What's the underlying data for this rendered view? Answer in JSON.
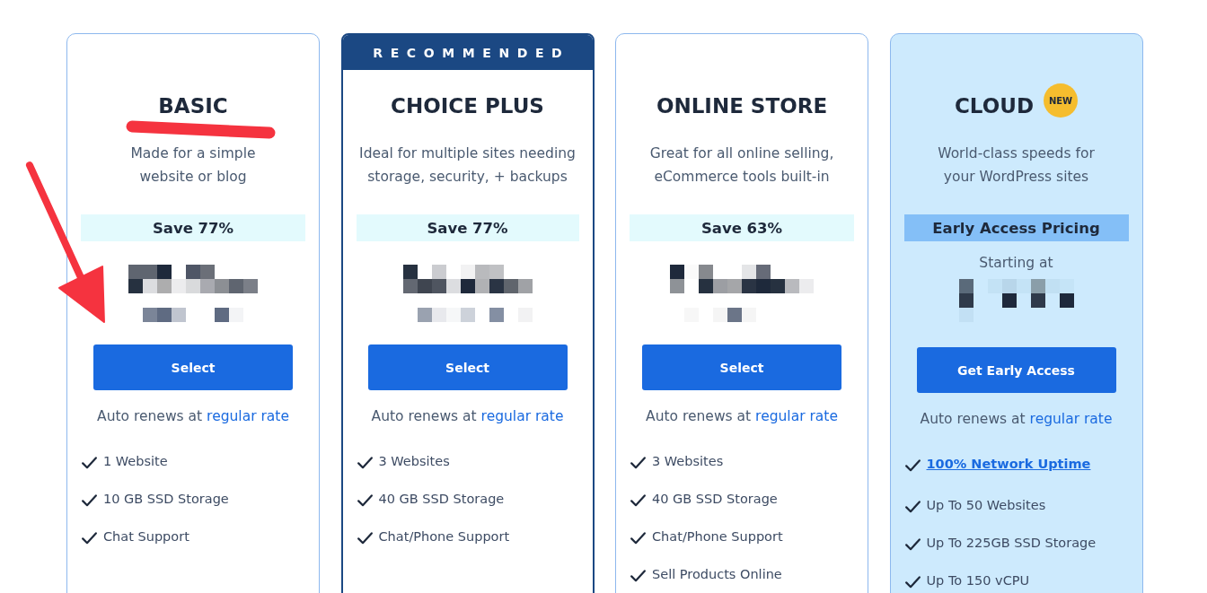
{
  "plans": [
    {
      "kind": "standard",
      "title": "BASIC",
      "description": [
        "Made for a simple",
        "website or blog"
      ],
      "deal": {
        "kind": "discount",
        "text": "Save 77%"
      },
      "button": "Select",
      "renewal": {
        "text": "Auto renews at",
        "link": "regular rate"
      },
      "features": [
        {
          "kind": "plain",
          "text": "1 Website"
        },
        {
          "kind": "plain",
          "text": "10 GB SSD Storage"
        },
        {
          "kind": "plain",
          "text": "Chat Support"
        }
      ]
    },
    {
      "kind": "recommended",
      "banner": "RECOMMENDED",
      "title": "CHOICE PLUS",
      "description": [
        "Ideal for multiple sites needing",
        "storage, security, + backups"
      ],
      "deal": {
        "kind": "discount",
        "text": "Save 77%"
      },
      "button": "Select",
      "renewal": {
        "text": "Auto renews at",
        "link": "regular rate"
      },
      "features": [
        {
          "kind": "plain",
          "text": "3 Websites"
        },
        {
          "kind": "plain",
          "text": "40 GB SSD Storage"
        },
        {
          "kind": "plain",
          "text": "Chat/Phone Support"
        }
      ]
    },
    {
      "kind": "standard",
      "title": "ONLINE STORE",
      "description": [
        "Great for all online selling,",
        "eCommerce tools built-in"
      ],
      "deal": {
        "kind": "discount",
        "text": "Save 63%"
      },
      "button": "Select",
      "renewal": {
        "text": "Auto renews at",
        "link": "regular rate"
      },
      "features": [
        {
          "kind": "plain",
          "text": "3 Websites"
        },
        {
          "kind": "plain",
          "text": "40 GB SSD Storage"
        },
        {
          "kind": "plain",
          "text": "Chat/Phone Support"
        },
        {
          "kind": "plain",
          "text": "Sell Products Online"
        }
      ]
    },
    {
      "kind": "featured",
      "title": "CLOUD",
      "badge": "NEW",
      "description": [
        "World-class speeds for",
        "your WordPress sites"
      ],
      "deal": {
        "kind": "early_access",
        "text": "Early Access Pricing"
      },
      "price_prefix": "Starting at",
      "button": "Get Early Access",
      "renewal": {
        "text": "Auto renews at",
        "link": "regular rate"
      },
      "features": [
        {
          "kind": "link",
          "text": "100% Network Uptime"
        },
        {
          "kind": "plain",
          "text": "Up To 50 Websites"
        },
        {
          "kind": "plain",
          "text": "Up To 225GB SSD Storage"
        },
        {
          "kind": "plain",
          "text": "Up To 150 vCPU"
        }
      ]
    }
  ],
  "annotations": [
    {
      "kind": "underline"
    },
    {
      "kind": "arrow"
    }
  ]
}
